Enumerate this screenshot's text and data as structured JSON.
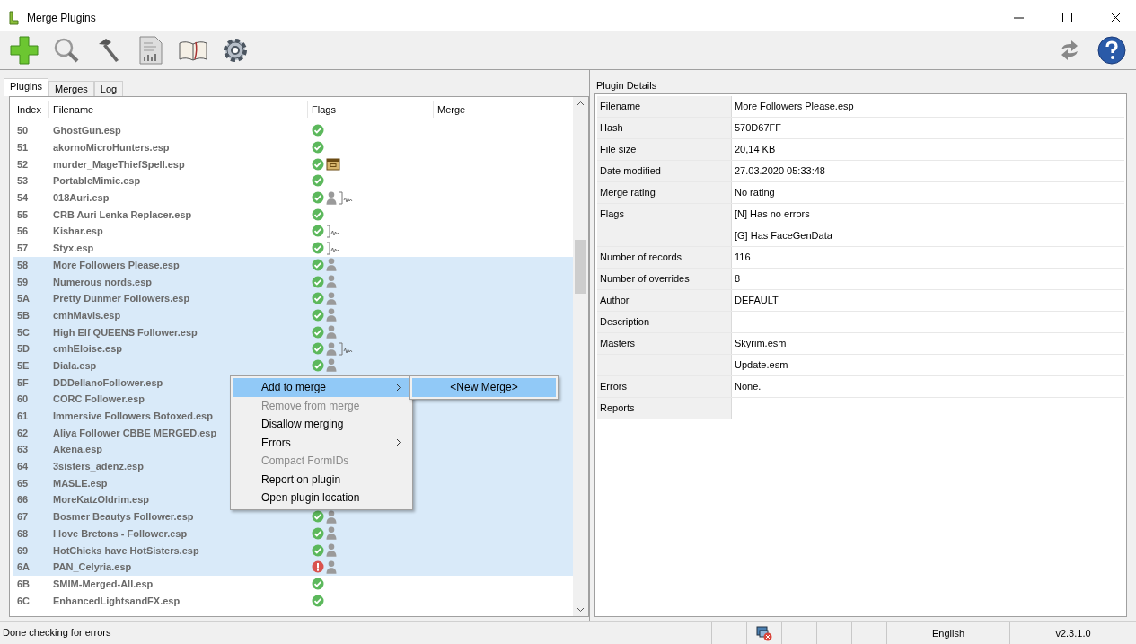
{
  "window": {
    "title": "Merge Plugins"
  },
  "tabs": [
    {
      "label": "Plugins",
      "selected": true
    },
    {
      "label": "Merges",
      "selected": false
    },
    {
      "label": "Log",
      "selected": false
    }
  ],
  "plugins_table": {
    "columns": [
      "Index",
      "Filename",
      "Flags",
      "Merge"
    ],
    "rows": [
      {
        "index": "50",
        "filename": "GhostGun.esp",
        "flags": [
          {
            "kind": "ok"
          }
        ],
        "selected": false
      },
      {
        "index": "51",
        "filename": "akornoMicroHunters.esp",
        "flags": [
          {
            "kind": "ok"
          }
        ],
        "selected": false
      },
      {
        "index": "52",
        "filename": "murder_MageThiefSpell.esp",
        "flags": [
          {
            "kind": "ok"
          },
          {
            "kind": "archive"
          }
        ],
        "selected": false
      },
      {
        "index": "53",
        "filename": "PortableMimic.esp",
        "flags": [
          {
            "kind": "ok"
          }
        ],
        "selected": false
      },
      {
        "index": "54",
        "filename": "018Auri.esp",
        "flags": [
          {
            "kind": "ok"
          },
          {
            "kind": "facegen"
          },
          {
            "kind": "voice"
          }
        ],
        "selected": false
      },
      {
        "index": "55",
        "filename": "CRB Auri Lenka Replacer.esp",
        "flags": [
          {
            "kind": "ok"
          }
        ],
        "selected": false
      },
      {
        "index": "56",
        "filename": "Kishar.esp",
        "flags": [
          {
            "kind": "ok"
          },
          {
            "kind": "voice"
          }
        ],
        "selected": false
      },
      {
        "index": "57",
        "filename": "Styx.esp",
        "flags": [
          {
            "kind": "ok"
          },
          {
            "kind": "voice"
          }
        ],
        "selected": false
      },
      {
        "index": "58",
        "filename": "More Followers Please.esp",
        "flags": [
          {
            "kind": "ok"
          },
          {
            "kind": "facegen"
          }
        ],
        "selected": true
      },
      {
        "index": "59",
        "filename": "Numerous nords.esp",
        "flags": [
          {
            "kind": "ok"
          },
          {
            "kind": "facegen"
          }
        ],
        "selected": true
      },
      {
        "index": "5A",
        "filename": "Pretty Dunmer Followers.esp",
        "flags": [
          {
            "kind": "ok"
          },
          {
            "kind": "facegen"
          }
        ],
        "selected": true
      },
      {
        "index": "5B",
        "filename": "cmhMavis.esp",
        "flags": [
          {
            "kind": "ok"
          },
          {
            "kind": "facegen"
          }
        ],
        "selected": true
      },
      {
        "index": "5C",
        "filename": "High Elf QUEENS Follower.esp",
        "flags": [
          {
            "kind": "ok"
          },
          {
            "kind": "facegen"
          }
        ],
        "selected": true
      },
      {
        "index": "5D",
        "filename": "cmhEloise.esp",
        "flags": [
          {
            "kind": "ok"
          },
          {
            "kind": "facegen"
          },
          {
            "kind": "voice"
          }
        ],
        "selected": true
      },
      {
        "index": "5E",
        "filename": "Diala.esp",
        "flags": [
          {
            "kind": "ok"
          },
          {
            "kind": "facegen"
          }
        ],
        "selected": true
      },
      {
        "index": "5F",
        "filename": "DDDellanoFollower.esp",
        "selected": true
      },
      {
        "index": "60",
        "filename": "CORC Follower.esp",
        "selected": true
      },
      {
        "index": "61",
        "filename": "Immersive Followers Botoxed.esp",
        "selected": true
      },
      {
        "index": "62",
        "filename": "Aliya Follower CBBE MERGED.esp",
        "selected": true
      },
      {
        "index": "63",
        "filename": "Akena.esp",
        "selected": true
      },
      {
        "index": "64",
        "filename": "3sisters_adenz.esp",
        "selected": true
      },
      {
        "index": "65",
        "filename": "MASLE.esp",
        "selected": true
      },
      {
        "index": "66",
        "filename": "MoreKatzOldrim.esp",
        "selected": true
      },
      {
        "index": "67",
        "filename": "Bosmer Beautys Follower.esp",
        "flags": [
          {
            "kind": "ok"
          },
          {
            "kind": "facegen"
          }
        ],
        "selected": true
      },
      {
        "index": "68",
        "filename": "I love Bretons - Follower.esp",
        "flags": [
          {
            "kind": "ok"
          },
          {
            "kind": "facegen"
          }
        ],
        "selected": true
      },
      {
        "index": "69",
        "filename": "HotChicks have HotSisters.esp",
        "flags": [
          {
            "kind": "ok"
          },
          {
            "kind": "facegen"
          }
        ],
        "selected": true
      },
      {
        "index": "6A",
        "filename": "PAN_Celyria.esp",
        "flags": [
          {
            "kind": "error"
          },
          {
            "kind": "facegen"
          }
        ],
        "selected": true
      },
      {
        "index": "6B",
        "filename": "SMIM-Merged-All.esp",
        "flags": [
          {
            "kind": "ok"
          }
        ],
        "selected": false
      },
      {
        "index": "6C",
        "filename": "EnhancedLightsandFX.esp",
        "flags": [
          {
            "kind": "ok"
          }
        ],
        "selected": false
      }
    ]
  },
  "context_menu": {
    "items": [
      {
        "label": "Add to merge",
        "disabled": false,
        "submenu": true,
        "selected": true
      },
      {
        "label": "Remove from merge",
        "disabled": true,
        "submenu": false,
        "selected": false
      },
      {
        "label": "Disallow merging",
        "disabled": false,
        "submenu": false,
        "selected": false
      },
      {
        "label": "Errors",
        "disabled": false,
        "submenu": true,
        "selected": false
      },
      {
        "label": "Compact FormIDs",
        "disabled": true,
        "submenu": false,
        "selected": false
      },
      {
        "label": "Report on plugin",
        "disabled": false,
        "submenu": false,
        "selected": false
      },
      {
        "label": "Open plugin location",
        "disabled": false,
        "submenu": false,
        "selected": false
      }
    ],
    "submenu": {
      "items": [
        {
          "label": "<New Merge>",
          "selected": true
        }
      ]
    }
  },
  "plugin_details": {
    "title": "Plugin Details",
    "rows": [
      {
        "label": "Filename",
        "value": "More Followers Please.esp"
      },
      {
        "label": "Hash",
        "value": "570D67FF"
      },
      {
        "label": "File size",
        "value": "20,14 KB"
      },
      {
        "label": "Date modified",
        "value": "27.03.2020 05:33:48"
      },
      {
        "label": "Merge rating",
        "value": "No rating"
      },
      {
        "label": "Flags",
        "value": "[N] Has no errors"
      },
      {
        "value": "[G] Has FaceGenData"
      },
      {
        "label": "Number of records",
        "value": "116"
      },
      {
        "label": "Number of overrides",
        "value": "8"
      },
      {
        "label": "Author",
        "value": "DEFAULT"
      },
      {
        "label": "Description"
      },
      {
        "label": "Masters",
        "value": "Skyrim.esm"
      },
      {
        "value": "Update.esm"
      },
      {
        "label": "Errors",
        "value": "None."
      },
      {
        "label": "Reports"
      }
    ]
  },
  "status_bar": {
    "message": "Done checking for errors",
    "language": "English",
    "version": "v2.3.1.0"
  }
}
